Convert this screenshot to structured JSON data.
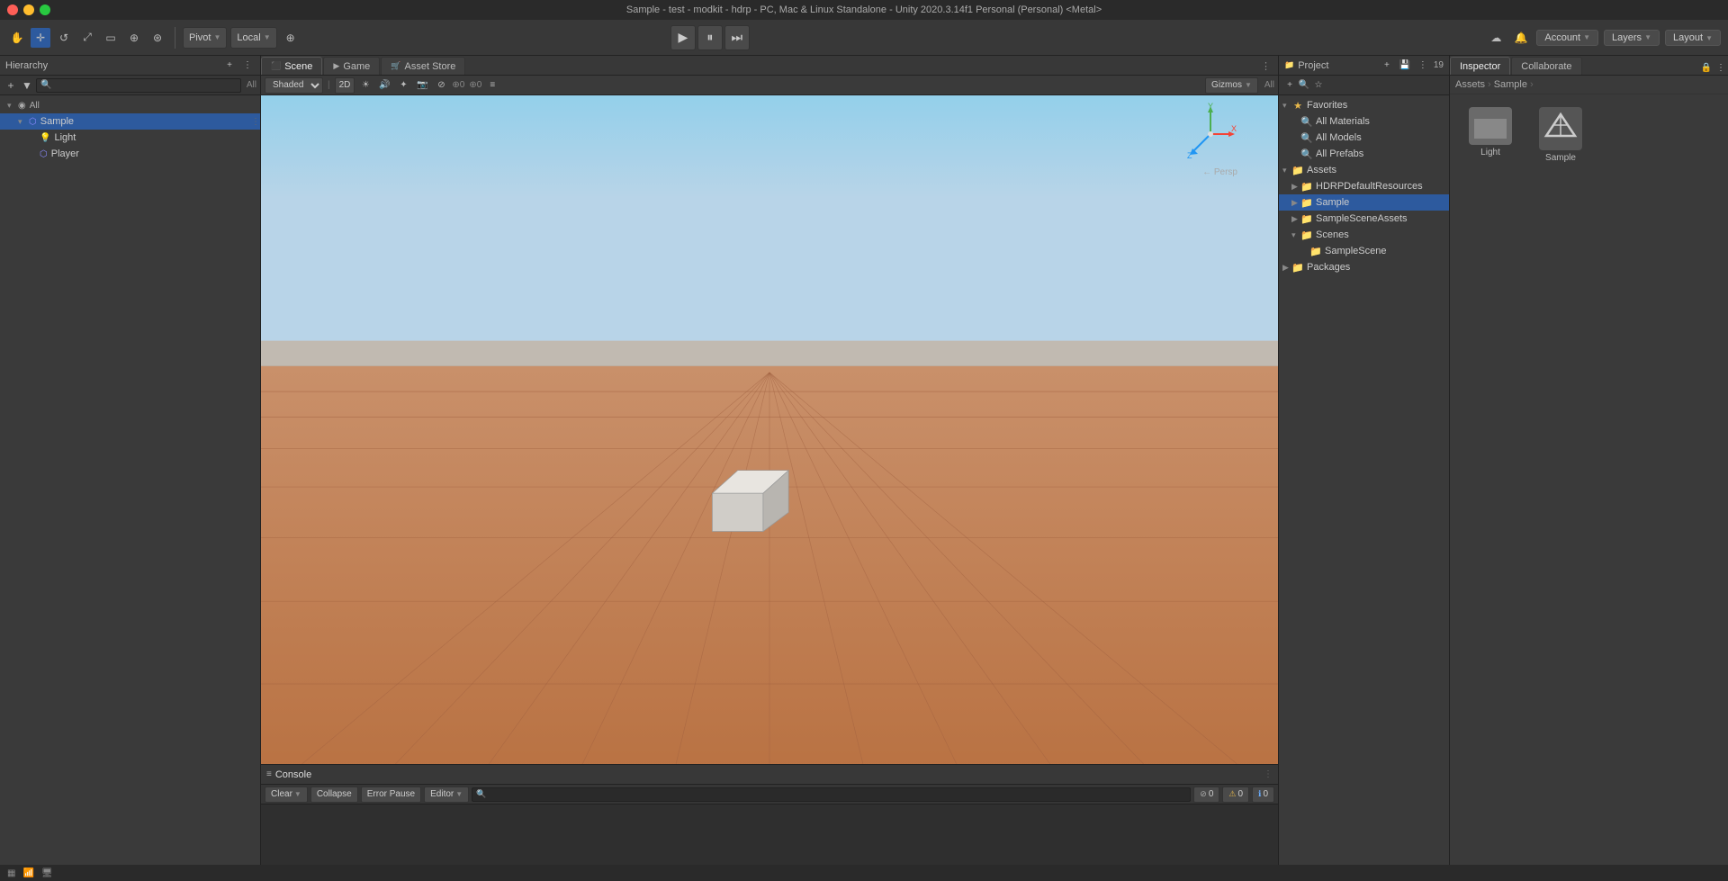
{
  "titleBar": {
    "title": "Sample - test - modkit - hdrp - PC, Mac & Linux Standalone - Unity 2020.3.14f1 Personal (Personal) <Metal>"
  },
  "toolbar": {
    "transformTools": [
      "hand",
      "move",
      "rotate",
      "scale",
      "rect",
      "transform"
    ],
    "pivotLabel": "Pivot",
    "localLabel": "Local",
    "extraTool": "⊕",
    "playBtn": "▶",
    "pauseBtn": "⏸",
    "stepBtn": "⏭",
    "accountLabel": "Account",
    "layersLabel": "Layers",
    "layoutLabel": "Layout"
  },
  "hierarchy": {
    "title": "Hierarchy",
    "allLabel": "All",
    "items": [
      {
        "name": "Sample",
        "level": 1,
        "hasArrow": true,
        "icon": "🎮"
      },
      {
        "name": "Light",
        "level": 2,
        "hasArrow": false,
        "icon": "💡"
      },
      {
        "name": "Player",
        "level": 2,
        "hasArrow": false,
        "icon": "🎮"
      }
    ]
  },
  "scene": {
    "title": "Scene",
    "shadingMode": "Shaded",
    "is2D": "2D",
    "gizmosLabel": "Gizmos",
    "allLabel": "All",
    "perspLabel": "← Persp"
  },
  "game": {
    "title": "Game"
  },
  "assetStore": {
    "title": "Asset Store"
  },
  "project": {
    "title": "Project",
    "breadcrumb": [
      "Assets",
      "Sample"
    ],
    "tree": {
      "favorites": {
        "label": "Favorites",
        "items": [
          {
            "name": "All Materials",
            "icon": "search"
          },
          {
            "name": "All Models",
            "icon": "search"
          },
          {
            "name": "All Prefabs",
            "icon": "search"
          }
        ]
      },
      "assets": {
        "label": "Assets",
        "items": [
          {
            "name": "HDRPDefaultResources",
            "icon": "folder"
          },
          {
            "name": "Sample",
            "icon": "folder",
            "selected": true
          },
          {
            "name": "SampleSceneAssets",
            "icon": "folder"
          },
          {
            "name": "Scenes",
            "icon": "folder",
            "items": [
              {
                "name": "SampleScene",
                "icon": "folder"
              }
            ]
          },
          {
            "name": "Packages",
            "icon": "folder"
          }
        ]
      }
    },
    "assets": [
      {
        "name": "Light",
        "type": "folder"
      },
      {
        "name": "Sample",
        "type": "unity"
      }
    ]
  },
  "inspector": {
    "title": "Inspector"
  },
  "collaborate": {
    "title": "Collaborate"
  },
  "console": {
    "title": "Console",
    "clearLabel": "Clear",
    "collapseLabel": "Collapse",
    "errorPauseLabel": "Error Pause",
    "editorLabel": "Editor",
    "errorCount": "0",
    "warningCount": "0",
    "messageCount": "0"
  },
  "statusBar": {
    "icons": [
      "grid",
      "wifi",
      "monitor"
    ]
  }
}
